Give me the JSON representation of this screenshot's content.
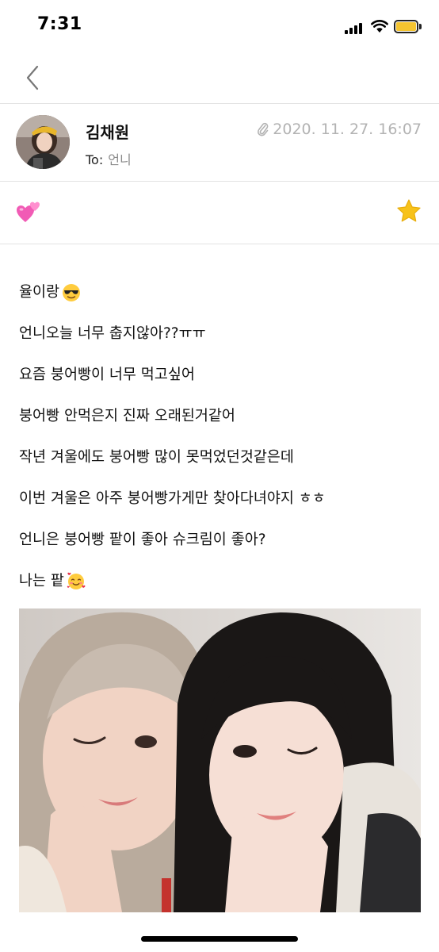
{
  "status_bar": {
    "time": "7:31",
    "battery_color": "#f4c430"
  },
  "nav": {
    "back_icon": "chevron-left-icon"
  },
  "letter": {
    "sender_name": "김채원",
    "to_label": "To:",
    "to_value": "언니",
    "attachment_icon": "paperclip-icon",
    "date": "2020. 11. 27. 16:07",
    "reaction_icon": "two-hearts-icon",
    "favorite_icon": "star-icon",
    "lines": [
      {
        "text": "율이랑",
        "emoji": "sunglasses-face"
      },
      {
        "text": "언니오늘 너무 춥지않아??ㅠㅠ",
        "emoji": null
      },
      {
        "text": "요즘 붕어빵이 너무 먹고싶어",
        "emoji": null
      },
      {
        "text": "붕어빵 안먹은지 진짜 오래된거같어",
        "emoji": null
      },
      {
        "text": "작년 겨울에도 붕어빵 많이 못먹었던것같은데",
        "emoji": null
      },
      {
        "text": "이번 겨울은 아주 붕어빵가게만 찾아다녀야지 ㅎㅎ",
        "emoji": null
      },
      {
        "text": "언니은 붕어빵 팥이 좋아 슈크림이 좋아?",
        "emoji": null
      },
      {
        "text": "나는 팥",
        "emoji": "smiling-face-with-hearts"
      }
    ]
  },
  "colors": {
    "accent": "#f4c430",
    "muted_text": "#b3b3b3",
    "divider": "#e3e3e3"
  }
}
